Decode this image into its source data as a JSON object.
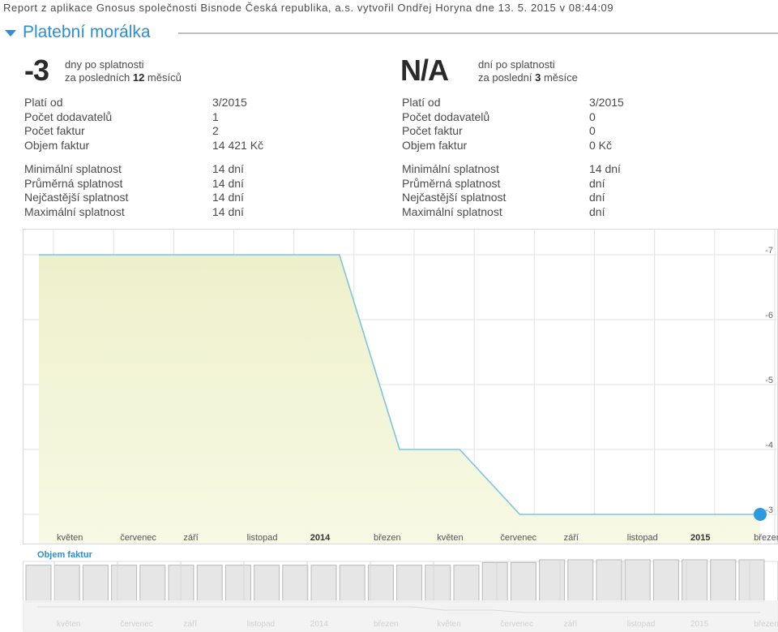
{
  "report_header": "Report z aplikace Gnosus společnosti Bisnode Česká republika, a.s. vytvořil Ondřej Horyna dne 13. 5. 2015 v 08:44:09",
  "section": {
    "title": "Platební morálka"
  },
  "left_metric": {
    "value": "-3",
    "line1": "dny po splatnosti",
    "line2_prefix": "za posledních ",
    "line2_bold": "12",
    "line2_suffix": " měsíců"
  },
  "right_metric": {
    "value": "N/A",
    "line1": "dní po splatnosti",
    "line2_prefix": "za poslední ",
    "line2_bold": "3",
    "line2_suffix": " měsíce"
  },
  "left_stats": {
    "block1": [
      {
        "label": "Platí od",
        "value": "3/2015"
      },
      {
        "label": "Počet dodavatelů",
        "value": "1"
      },
      {
        "label": "Počet faktur",
        "value": "2"
      },
      {
        "label": "Objem faktur",
        "value": "14 421 Kč"
      }
    ],
    "block2": [
      {
        "label": "Minimální splatnost",
        "value": "14 dní"
      },
      {
        "label": "Průměrná splatnost",
        "value": "14 dní"
      },
      {
        "label": "Nejčastější splatnost",
        "value": "14 dní"
      },
      {
        "label": "Maximální splatnost",
        "value": "14 dní"
      }
    ]
  },
  "right_stats": {
    "block1": [
      {
        "label": "Platí od",
        "value": "3/2015"
      },
      {
        "label": "Počet dodavatelů",
        "value": "0"
      },
      {
        "label": "Počet faktur",
        "value": "0"
      },
      {
        "label": "Objem faktur",
        "value": "0 Kč"
      }
    ],
    "block2": [
      {
        "label": "Minimální splatnost",
        "value": "14 dní"
      },
      {
        "label": "Průměrná splatnost",
        "value": "dní"
      },
      {
        "label": "Nejčastější splatnost",
        "value": "dní"
      },
      {
        "label": "Maximální splatnost",
        "value": "dní"
      }
    ]
  },
  "chart_data": {
    "type": "area",
    "title": "",
    "xlabel": "",
    "ylabel": "",
    "x_ticks": [
      "květen",
      "červenec",
      "září",
      "listopad",
      "2014",
      "březen",
      "květen",
      "červenec",
      "září",
      "listopad",
      "2015",
      "březen"
    ],
    "x_ticks_bold": [
      "2014",
      "2015"
    ],
    "y_ticks": [
      -7,
      -6,
      -5,
      -4,
      -3
    ],
    "ylim": [
      -2.55,
      -7.4
    ],
    "y_axis_side": "right",
    "x_months_range": [
      "2013-04",
      "2015-04"
    ],
    "series": [
      {
        "points": [
          {
            "x": "2013-04",
            "y": -7
          },
          {
            "x": "2014-02",
            "y": -7
          },
          {
            "x": "2014-04",
            "y": -4
          },
          {
            "x": "2014-06",
            "y": -4
          },
          {
            "x": "2014-08",
            "y": -3
          },
          {
            "x": "2015-04",
            "y": -3
          }
        ],
        "color": "#7dc3e8",
        "fill": "#f2f4d6"
      }
    ],
    "highlight_point": {
      "x": "2015-04",
      "y": -3,
      "color": "#2b9be0"
    },
    "legend": {
      "label": "Objem faktur",
      "color": "#2b8fd8",
      "placement": "bottom-left"
    },
    "navigator_bars": [
      0.7,
      0.7,
      0.7,
      0.7,
      0.7,
      0.7,
      0.7,
      0.7,
      0.7,
      0.7,
      0.7,
      0.7,
      0.7,
      0.7,
      0.7,
      0.7,
      0.85,
      0.85,
      1.0,
      1.0,
      1.0,
      1.0,
      1.0,
      1.0,
      1.0,
      1.0
    ]
  }
}
